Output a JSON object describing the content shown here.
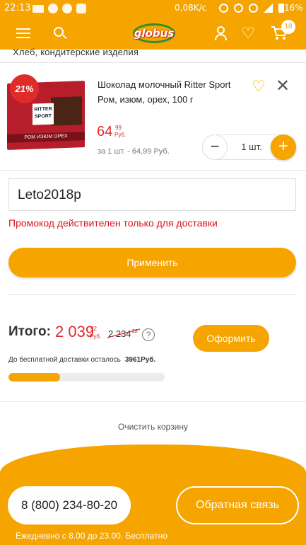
{
  "status_bar": {
    "time": "22:13",
    "net_speed": "0,08K/c",
    "battery": "16%"
  },
  "header": {
    "logo_text": "globus",
    "cart_count": "18",
    "brand_color": "#f5a400"
  },
  "category": "Хлеб, кондитерские изделия",
  "product": {
    "name": "Шоколад молочный Ritter Sport Ром, изюм, орех, 100 г",
    "discount_badge": "21%",
    "image_brand_text": "RITTER SPORT",
    "image_band_text": "РОМ ИЗЮМ ОРЕХ",
    "price_int": "64",
    "price_kop": "99",
    "price_currency": "Руб.",
    "unit_price": "за 1 шт. - 64,99 Руб.",
    "quantity": "1 шт.",
    "minus_label": "−",
    "plus_label": "+"
  },
  "promo": {
    "value": "Leto2018p",
    "error": "Промокод действителен только для доставки",
    "apply_label": "Применить"
  },
  "total": {
    "label": "Итого:",
    "value": "2 039",
    "kop": "82",
    "currency": "Руб.",
    "old_value": "2 234",
    "old_kop": "22",
    "help_label": "?",
    "checkout_label": "Оформить"
  },
  "free_delivery": {
    "text": "До бесплатной доставки осталось",
    "amount": "3961Руб.",
    "progress": 0.33
  },
  "clear_label": "Очистить корзину",
  "footer": {
    "phone": "8 (800) 234-80-20",
    "feedback_label": "Обратная связь",
    "hours": "Ежедневно с 8.00 до 23.00. Бесплатно"
  }
}
